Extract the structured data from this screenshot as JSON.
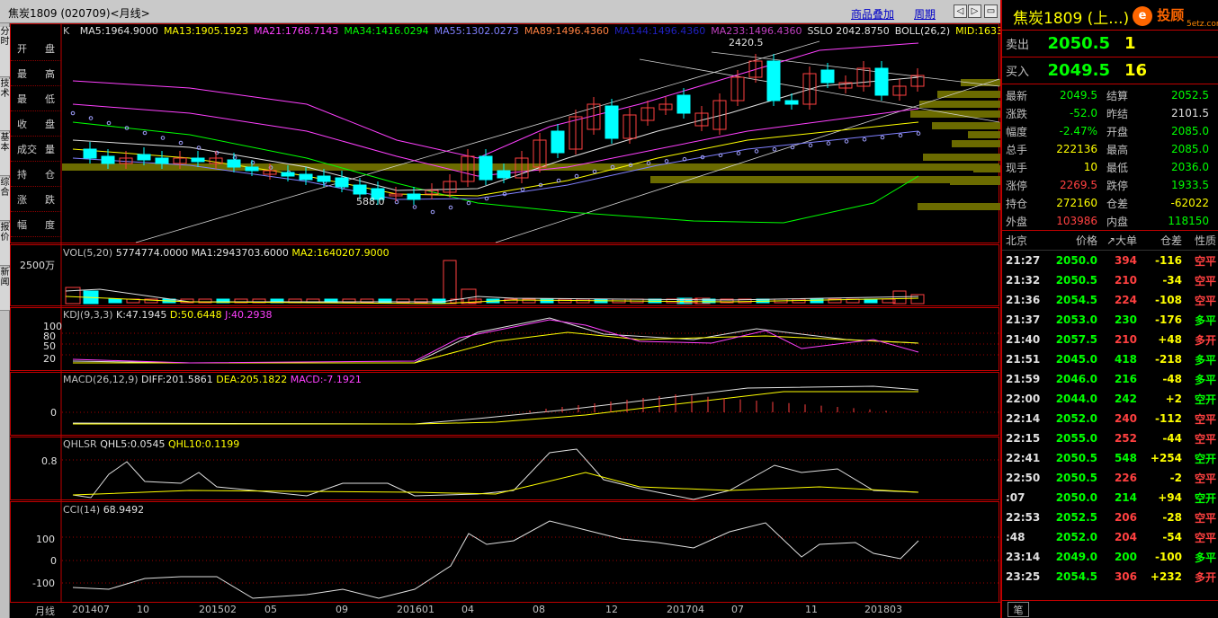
{
  "window": {
    "title": "焦炭1809 (020709)<月线>",
    "link_overlay": "商品叠加",
    "link_period": "周期",
    "nav_buttons": [
      "◁",
      "▷",
      "▭",
      "✕"
    ]
  },
  "left_tabs": [
    "分时",
    "技术",
    "基本",
    "综合",
    "报价",
    "新闻"
  ],
  "side_labels": [
    {
      "a": "开",
      "b": "盘"
    },
    {
      "a": "最",
      "b": "高"
    },
    {
      "a": "最",
      "b": "低"
    },
    {
      "a": "收",
      "b": "盘"
    },
    {
      "a": "成交",
      "b": "量"
    },
    {
      "a": "持",
      "b": "仓"
    },
    {
      "a": "涨",
      "b": "跌"
    },
    {
      "a": "幅",
      "b": "度"
    }
  ],
  "main_indicator": {
    "prefix": "K",
    "items": [
      {
        "text": "MA5:1964.9000",
        "color": "#e0e0e0"
      },
      {
        "text": "MA13:1905.1923",
        "color": "#ffff00"
      },
      {
        "text": "MA21:1768.7143",
        "color": "#ff40ff"
      },
      {
        "text": "MA34:1416.0294",
        "color": "#00ff00"
      },
      {
        "text": "MA55:1302.0273",
        "color": "#8080ff"
      },
      {
        "text": "MA89:1496.4360",
        "color": "#ff8040"
      },
      {
        "text": "MA144:1496.4360",
        "color": "#2020c0"
      },
      {
        "text": "MA233:1496.4360",
        "color": "#c040c0"
      },
      {
        "text": "SSLO 2042.8750",
        "color": "#e0e0e0"
      },
      {
        "text": "BOLL(26,2)",
        "color": "#e0e0e0"
      },
      {
        "text": "MID:1633",
        "color": "#ffff00"
      }
    ],
    "high_label": "2420.5",
    "low_label": "588.0"
  },
  "vol_panel": {
    "title": "VOL(5,20)",
    "v": "5774774.0000",
    "ma1": "MA1:2943703.6000",
    "ma2": "MA2:1640207.9000",
    "scale": "2500万"
  },
  "kdj_panel": {
    "title": "KDJ(9,3,3)",
    "k": "K:47.1945",
    "d": "D:50.6448",
    "j": "J:40.2938",
    "ticks": [
      "100",
      "80",
      "50",
      "20"
    ]
  },
  "macd_panel": {
    "title": "MACD(26,12,9)",
    "diff": "DIFF:201.5861",
    "dea": "DEA:205.1822",
    "macd": "MACD:-7.1921",
    "tick": "0"
  },
  "qhl_panel": {
    "title": "QHLSR",
    "q5": "QHL5:0.0545",
    "q10": "QHL10:0.1199",
    "tick": "0.8"
  },
  "cci_panel": {
    "title": "CCI(14)",
    "value": "68.9492",
    "ticks": [
      "100",
      "0",
      "-100"
    ]
  },
  "x_axis": {
    "period_label": "月线",
    "labels": [
      "201407",
      "10",
      "201502",
      "05",
      "09",
      "201601",
      "04",
      "08",
      "12",
      "201704",
      "07",
      "11",
      "201803"
    ]
  },
  "quote": {
    "name": "焦炭1809 (上...)",
    "logo": "投顾",
    "logo_sub": "5etz.com",
    "sell_label": "卖出",
    "sell_price": "2050.5",
    "sell_vol": "1",
    "buy_label": "买入",
    "buy_price": "2049.5",
    "buy_vol": "16",
    "stats": [
      {
        "k": "最新",
        "v": "2049.5",
        "vc": "grn",
        "k2": "结算",
        "v2": "2052.5",
        "v2c": "grn"
      },
      {
        "k": "涨跌",
        "v": "-52.0",
        "vc": "grn",
        "k2": "昨结",
        "v2": "2101.5",
        "v2c": "wht"
      },
      {
        "k": "幅度",
        "v": "-2.47%",
        "vc": "grn",
        "k2": "开盘",
        "v2": "2085.0",
        "v2c": "grn"
      },
      {
        "k": "总手",
        "v": "222136",
        "vc": "yel",
        "k2": "最高",
        "v2": "2085.0",
        "v2c": "grn"
      },
      {
        "k": "现手",
        "v": "10",
        "vc": "yel",
        "k2": "最低",
        "v2": "2036.0",
        "v2c": "grn"
      },
      {
        "k": "涨停",
        "v": "2269.5",
        "vc": "red",
        "k2": "跌停",
        "v2": "1933.5",
        "v2c": "grn"
      },
      {
        "k": "持仓",
        "v": "272160",
        "vc": "yel",
        "k2": "仓差",
        "v2": "-62022",
        "v2c": "yel"
      },
      {
        "k": "外盘",
        "v": "103986",
        "vc": "red",
        "k2": "内盘",
        "v2": "118150",
        "v2c": "grn"
      }
    ],
    "trade_headers": [
      "北京",
      "价格",
      "↗大单",
      "仓差",
      "性质"
    ],
    "trades": [
      {
        "t": "21:27",
        "p": "2050.0",
        "pc": "grn",
        "v": "394",
        "vc": "red",
        "d": "-116",
        "dc": "yel",
        "n": "空平",
        "nc": "red"
      },
      {
        "t": "21:32",
        "p": "2050.5",
        "pc": "grn",
        "v": "210",
        "vc": "red",
        "d": "-34",
        "dc": "yel",
        "n": "空平",
        "nc": "red"
      },
      {
        "t": "21:36",
        "p": "2054.5",
        "pc": "grn",
        "v": "224",
        "vc": "red",
        "d": "-108",
        "dc": "yel",
        "n": "空平",
        "nc": "red"
      },
      {
        "t": "21:37",
        "p": "2053.0",
        "pc": "grn",
        "v": "230",
        "vc": "grn",
        "d": "-176",
        "dc": "yel",
        "n": "多平",
        "nc": "grn"
      },
      {
        "t": "21:40",
        "p": "2057.5",
        "pc": "grn",
        "v": "210",
        "vc": "red",
        "d": "+48",
        "dc": "yel",
        "n": "多开",
        "nc": "red"
      },
      {
        "t": "21:51",
        "p": "2045.0",
        "pc": "grn",
        "v": "418",
        "vc": "grn",
        "d": "-218",
        "dc": "yel",
        "n": "多平",
        "nc": "grn"
      },
      {
        "t": "21:59",
        "p": "2046.0",
        "pc": "grn",
        "v": "216",
        "vc": "grn",
        "d": "-48",
        "dc": "yel",
        "n": "多平",
        "nc": "grn"
      },
      {
        "t": "22:00",
        "p": "2044.0",
        "pc": "grn",
        "v": "242",
        "vc": "grn",
        "d": "+2",
        "dc": "yel",
        "n": "空开",
        "nc": "grn"
      },
      {
        "t": "22:14",
        "p": "2052.0",
        "pc": "grn",
        "v": "240",
        "vc": "red",
        "d": "-112",
        "dc": "yel",
        "n": "空平",
        "nc": "red"
      },
      {
        "t": "22:15",
        "p": "2055.0",
        "pc": "grn",
        "v": "252",
        "vc": "red",
        "d": "-44",
        "dc": "yel",
        "n": "空平",
        "nc": "red"
      },
      {
        "t": "22:41",
        "p": "2050.5",
        "pc": "grn",
        "v": "548",
        "vc": "grn",
        "d": "+254",
        "dc": "yel",
        "n": "空开",
        "nc": "grn"
      },
      {
        "t": "22:50",
        "p": "2050.5",
        "pc": "grn",
        "v": "226",
        "vc": "red",
        "d": "-2",
        "dc": "yel",
        "n": "空平",
        "nc": "red"
      },
      {
        "t": ":07",
        "p": "2050.0",
        "pc": "grn",
        "v": "214",
        "vc": "grn",
        "d": "+94",
        "dc": "yel",
        "n": "空开",
        "nc": "grn"
      },
      {
        "t": "22:53",
        "p": "2052.5",
        "pc": "grn",
        "v": "206",
        "vc": "red",
        "d": "-28",
        "dc": "yel",
        "n": "空平",
        "nc": "red"
      },
      {
        "t": ":48",
        "p": "2052.0",
        "pc": "grn",
        "v": "204",
        "vc": "red",
        "d": "-54",
        "dc": "yel",
        "n": "空平",
        "nc": "red"
      },
      {
        "t": "23:14",
        "p": "2049.0",
        "pc": "grn",
        "v": "200",
        "vc": "grn",
        "d": "-100",
        "dc": "yel",
        "n": "多平",
        "nc": "grn"
      },
      {
        "t": "23:25",
        "p": "2054.5",
        "pc": "grn",
        "v": "306",
        "vc": "red",
        "d": "+232",
        "dc": "yel",
        "n": "多开",
        "nc": "red"
      }
    ],
    "footer_tab": "笔"
  },
  "colors": {
    "up": "#ff4040",
    "down": "#00ffff",
    "grid": "#c00000",
    "ma5": "#e0e0e0",
    "ma13": "#ffff00",
    "ma21": "#ff40ff",
    "ma34": "#00ff00",
    "ma55": "#8080ff"
  }
}
